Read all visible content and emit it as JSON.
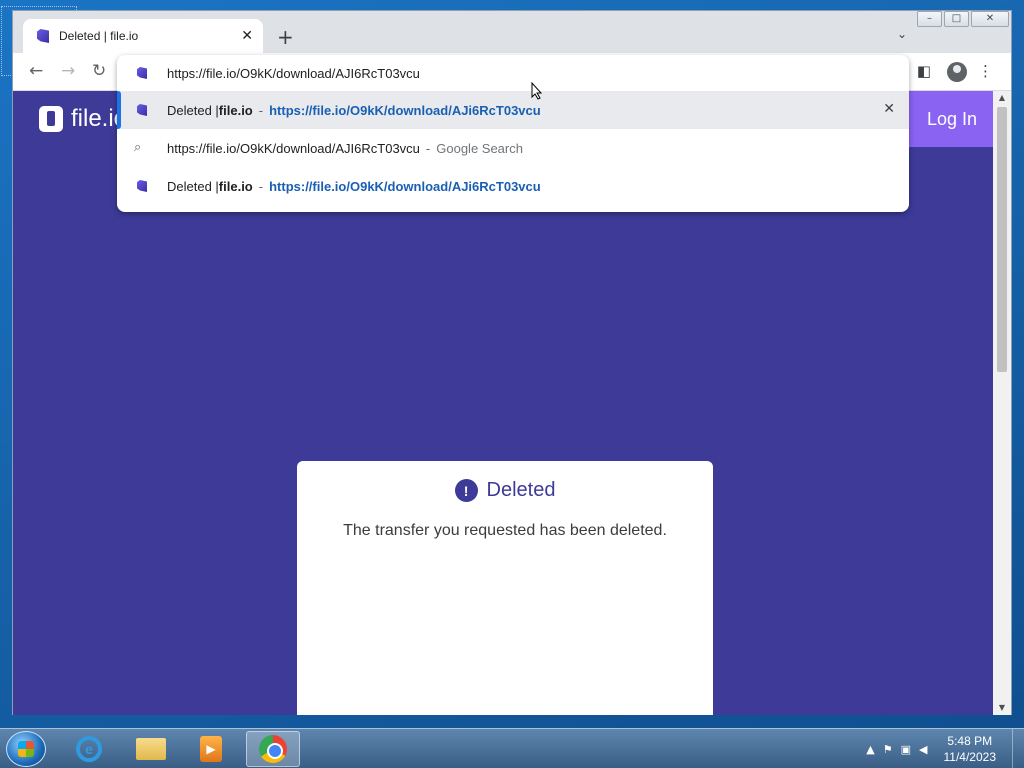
{
  "browser": {
    "tab": {
      "title": "Deleted | file.io"
    },
    "window_controls": {
      "minimize": "–",
      "maximize": "□",
      "close": "✕"
    },
    "address_bar": {
      "value": "https://file.io/O9kK/download/AJI6RcT03vcu"
    },
    "suggestions": [
      {
        "title": "Deleted | ",
        "site": "file.io",
        "separator": "-",
        "url": "https://file.io/O9kK/download/AJi6RcT03vcu",
        "selected": true
      },
      {
        "query": "https://file.io/O9kK/download/AJI6RcT03vcu",
        "separator": "-",
        "suffix": "Google Search"
      },
      {
        "title": "Deleted | ",
        "site": "file.io",
        "separator": "-",
        "url": "https://file.io/O9kK/download/AJi6RcT03vcu"
      }
    ]
  },
  "page": {
    "logo_text": "file.io",
    "login_label": "Log In",
    "card": {
      "alert_icon": "!",
      "title": "Deleted",
      "message": "The transfer you requested has been deleted."
    },
    "colors": {
      "background": "#3d3a98",
      "login_button": "#8a63f2"
    }
  },
  "taskbar": {
    "apps": [
      "internet-explorer",
      "file-explorer",
      "media-player",
      "chrome"
    ],
    "time": "5:48 PM",
    "date": "11/4/2023"
  }
}
